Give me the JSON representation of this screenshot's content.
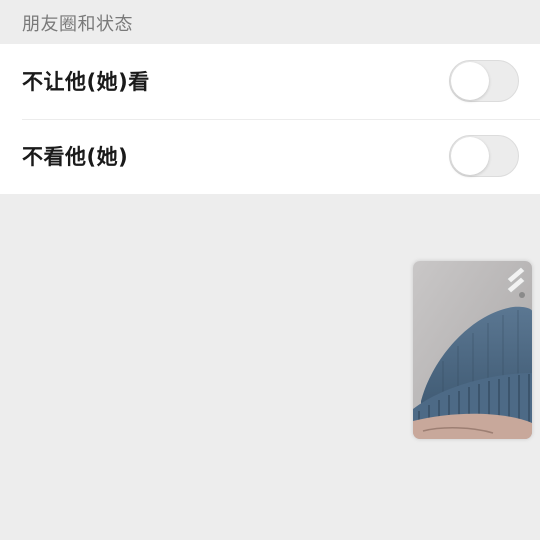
{
  "section": {
    "header": "朋友圈和状态"
  },
  "rows": [
    {
      "label": "不让他(她)看",
      "toggle_on": false
    },
    {
      "label": "不看他(她)",
      "toggle_on": false
    }
  ],
  "colors": {
    "background": "#ededed",
    "card": "#ffffff",
    "toggle_off": "#ececec",
    "text": "#1a1a1a",
    "header_text": "#7a7a7a"
  },
  "icons": {
    "floating_video": "video-call-thumbnail",
    "switch": "camera-switch-icon"
  }
}
